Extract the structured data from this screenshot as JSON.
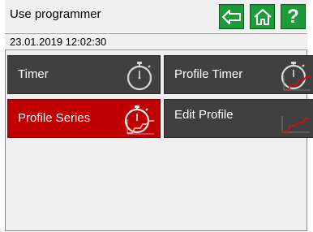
{
  "header": {
    "title": "Use programmer",
    "buttons": [
      {
        "name": "back",
        "icon": "arrow-left-icon"
      },
      {
        "name": "home",
        "icon": "home-icon"
      },
      {
        "name": "help",
        "icon": "question-icon",
        "glyph": "?"
      }
    ],
    "button_color": "#1f9a3a"
  },
  "status": {
    "datetime": "23.01.2019 12:02:30"
  },
  "tiles": [
    {
      "label": "Timer",
      "icon": "stopwatch-icon",
      "selected": false
    },
    {
      "label": "Profile Timer",
      "icon": "stopwatch-profile-icon",
      "selected": false
    },
    {
      "label": "Profile Series",
      "icon": "stopwatch-profile-icon",
      "selected": true
    },
    {
      "label": "Edit Profile",
      "icon": "profile-graph-icon",
      "selected": false
    }
  ],
  "colors": {
    "tile_background": "#404040",
    "tile_selected": "#c00000",
    "profile_line": "#d01010"
  }
}
